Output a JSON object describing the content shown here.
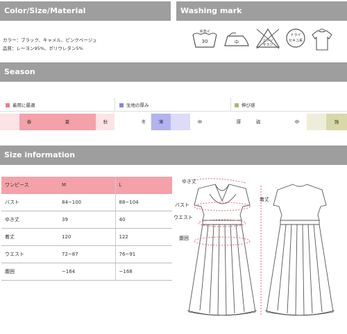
{
  "headers": {
    "color": "Color/Size/Material",
    "washing": "Washing mark",
    "season": "Season",
    "size": "Size information"
  },
  "material": {
    "color_line": "カラー：ブラック、キャメル、ピンクベージュ",
    "fabric_line": "品質：レーヨン95%、ポリウレタン5%"
  },
  "washing_icons": [
    {
      "name": "hand-wash-icon",
      "text1": "手洗イ",
      "text2": "30"
    },
    {
      "name": "iron-medium-icon",
      "text1": "中"
    },
    {
      "name": "no-bleach-icon",
      "text1": "エンソ",
      "text2": "サラシ"
    },
    {
      "name": "dry-clean-icon",
      "text1": "ドライ",
      "text2": "セキユ系"
    },
    {
      "name": "hang-dry-icon"
    }
  ],
  "season": {
    "legend": {
      "best": "着用に最適",
      "thickness": "生地の厚み",
      "stretch": "伸び感"
    },
    "colors": {
      "best_legend": "#f27a88",
      "thickness_legend": "#8585e6",
      "stretch_legend": "#b5b56e",
      "season_light": "#fce3e6",
      "season_strong": "#f4a1a9",
      "thick_strong": "#b3b3f0",
      "thick_light": "#dcdcf8",
      "stretch_strong": "#d8d8a8",
      "stretch_light": "#eeeed8"
    },
    "seasons": [
      "春",
      "夏",
      "秋",
      "冬"
    ],
    "thickness": [
      "薄",
      "中",
      "厚"
    ],
    "stretch": [
      "弱",
      "中",
      "強"
    ]
  },
  "size_table": {
    "header": [
      "ワンピース",
      "M",
      "L"
    ],
    "rows": [
      [
        "バスト",
        "84~100",
        "88~104"
      ],
      [
        "ゆき丈",
        "39",
        "40"
      ],
      [
        "着丈",
        "120",
        "122"
      ],
      [
        "ウエスト",
        "72~87",
        "76~91"
      ],
      [
        "腹囲",
        "~164",
        "~168"
      ]
    ]
  },
  "diagram_labels": {
    "sleeve": "ゆき丈",
    "bust": "バスト",
    "waist": "ウエスト",
    "hip": "腹囲",
    "length": "着丈"
  }
}
